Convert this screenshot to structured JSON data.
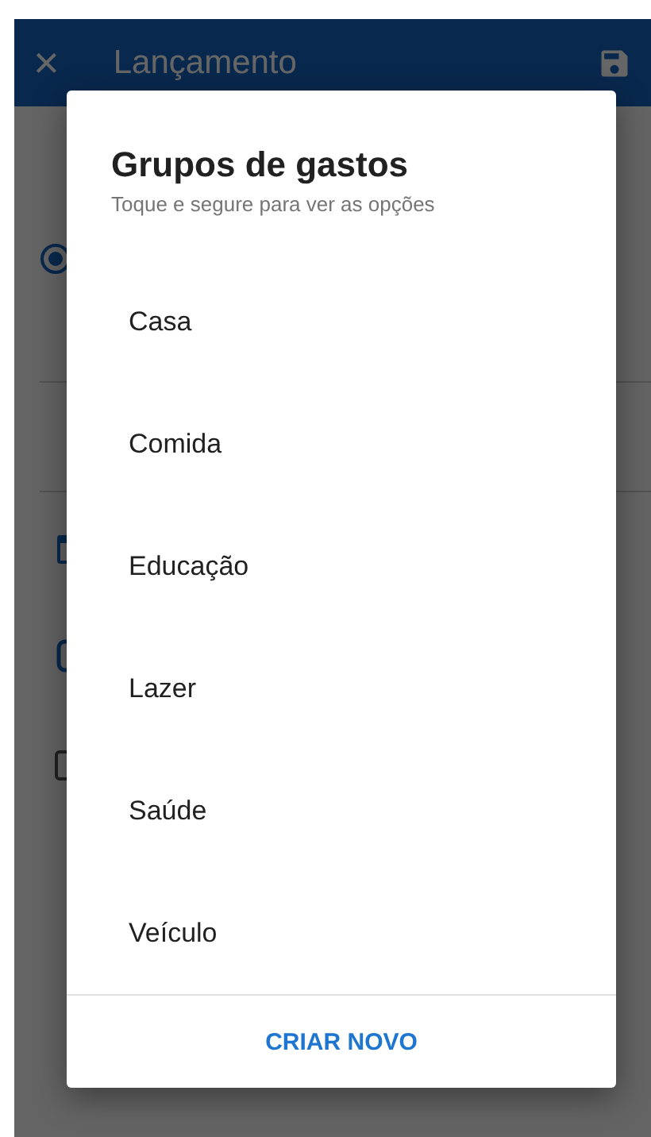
{
  "app_bar": {
    "close_icon": "×",
    "title": "Lançamento"
  },
  "background": {
    "radio_selected": true,
    "checkbox_checked": false
  },
  "dialog": {
    "title": "Grupos de gastos",
    "subtitle": "Toque e segure para ver as opções",
    "items": [
      {
        "label": "Casa"
      },
      {
        "label": "Comida"
      },
      {
        "label": "Educação"
      },
      {
        "label": "Lazer"
      },
      {
        "label": "Saúde"
      },
      {
        "label": "Veículo"
      }
    ],
    "action": "CRIAR NOVO"
  }
}
